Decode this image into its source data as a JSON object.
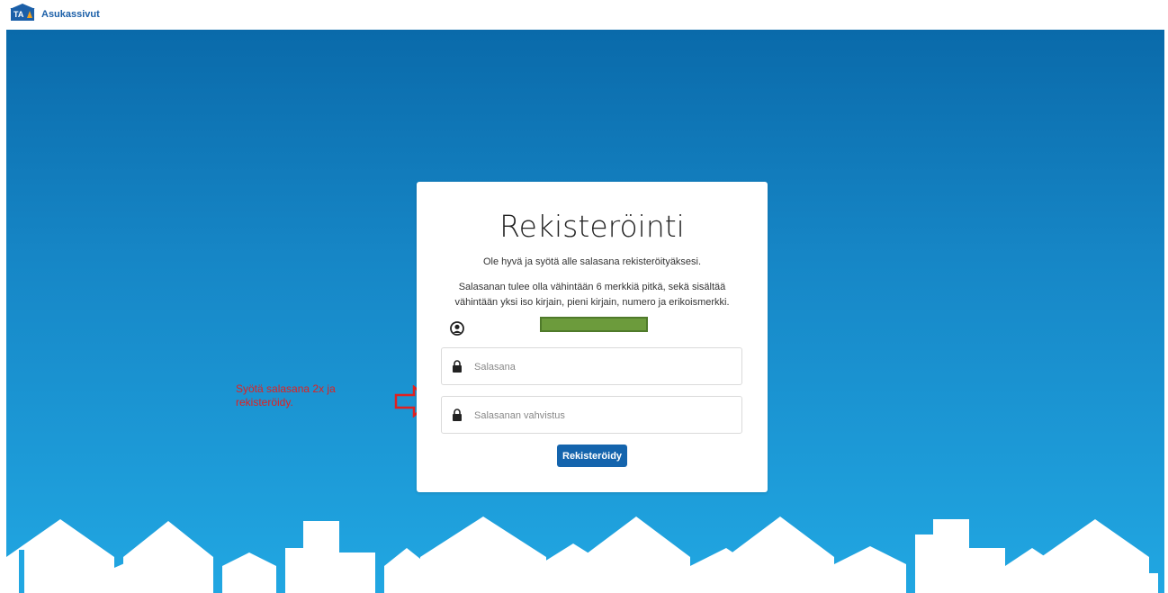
{
  "header": {
    "logo_text": "TA",
    "brand_name": "Asukassivut"
  },
  "card": {
    "title": "Rekisteröinti",
    "intro": "Ole hyvä ja syötä alle salasana rekisteröityäksesi.",
    "rules_line1": "Salasanan tulee olla vähintään 6 merkkiä pitkä, sekä sisältää",
    "rules_line2": "vähintään yksi iso kirjain, pieni kirjain, numero ja erikoismerkki.",
    "password_placeholder": "Salasana",
    "password_confirm_placeholder": "Salasanan vahvistus",
    "submit_label": "Rekisteröidy"
  },
  "annotation": {
    "line1": "Syötä salasana 2x ja",
    "line2": "rekisteröidy."
  },
  "colors": {
    "brand_blue": "#1b5fa8",
    "button_blue": "#1464ad",
    "annotation_red": "#e12020",
    "redaction_green": "#6c9b3c"
  }
}
